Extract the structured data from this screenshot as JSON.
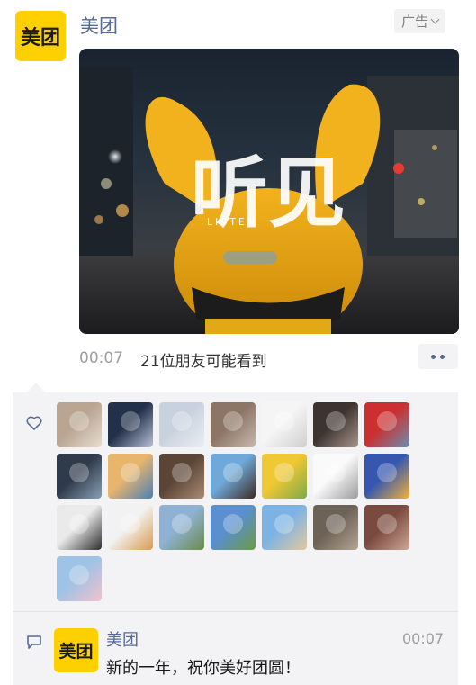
{
  "post": {
    "brand_logo_text": "美团",
    "name": "美团",
    "ad_label": "广告",
    "video_title": "听见",
    "video_subtitle": "LISTEN",
    "time": "00:07",
    "visibility": "21位朋友可能看到"
  },
  "likes": {
    "icon": "heart-outline-icon",
    "count_avatars": 22,
    "avatars": [
      {
        "name": "avatar-1",
        "c1": "#b9a592",
        "c2": "#e8ddd2"
      },
      {
        "name": "avatar-2",
        "c1": "#23304a",
        "c2": "#b7c1d8"
      },
      {
        "name": "avatar-3",
        "c1": "#c8d2de",
        "c2": "#e9eef4"
      },
      {
        "name": "avatar-4",
        "c1": "#8d7565",
        "c2": "#c7b9ad"
      },
      {
        "name": "avatar-5",
        "c1": "#f5f5f5",
        "c2": "#cfcfcf"
      },
      {
        "name": "avatar-6",
        "c1": "#3d3431",
        "c2": "#a9958a"
      },
      {
        "name": "avatar-7",
        "c1": "#cc2f2f",
        "c2": "#6a8fb0"
      },
      {
        "name": "avatar-8",
        "c1": "#2f3a4a",
        "c2": "#8aa0b6"
      },
      {
        "name": "avatar-9",
        "c1": "#e8b56d",
        "c2": "#4a7fb8"
      },
      {
        "name": "avatar-10",
        "c1": "#5b4536",
        "c2": "#a98c75"
      },
      {
        "name": "avatar-11",
        "c1": "#6fa9d9",
        "c2": "#3c2a22"
      },
      {
        "name": "avatar-12",
        "c1": "#f0c834",
        "c2": "#7ea94a"
      },
      {
        "name": "avatar-13",
        "c1": "#fafafa",
        "c2": "#9c9c9c"
      },
      {
        "name": "avatar-14",
        "c1": "#3557b0",
        "c2": "#f2b23a"
      },
      {
        "name": "avatar-15",
        "c1": "#eaeaea",
        "c2": "#2d2d2d"
      },
      {
        "name": "avatar-16",
        "c1": "#f2f2f2",
        "c2": "#d99a4e"
      },
      {
        "name": "avatar-17",
        "c1": "#8fb2d4",
        "c2": "#6c8a4b"
      },
      {
        "name": "avatar-18",
        "c1": "#5a8fd0",
        "c2": "#6b9a45"
      },
      {
        "name": "avatar-19",
        "c1": "#7cb3e4",
        "c2": "#e2c99d"
      },
      {
        "name": "avatar-20",
        "c1": "#6d6256",
        "c2": "#b4a594"
      },
      {
        "name": "avatar-21",
        "c1": "#7b4a3e",
        "c2": "#cfa89a"
      },
      {
        "name": "avatar-22",
        "c1": "#9fc3e6",
        "c2": "#f1c1cc"
      }
    ]
  },
  "comment": {
    "icon": "comment-bubble-icon",
    "logo_text": "美团",
    "name": "美团",
    "text": "新的一年，祝你美好团圆！",
    "time": "00:07"
  },
  "colors": {
    "brand_yellow": "#FFD000",
    "link_blue": "#576b95",
    "panel_bg": "#f3f3f5"
  }
}
